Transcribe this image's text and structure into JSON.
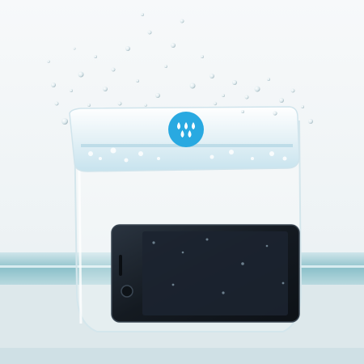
{
  "scene": {
    "description_tags": [
      "water",
      "splash",
      "waterproof-pouch",
      "smartphone",
      "aquarium"
    ],
    "colors": {
      "background": "#f3f6f7",
      "water_band_top": "#bfdbe0",
      "water_band_bottom": "#7fb7c1",
      "pouch_seal": "#e8f4f8",
      "logo_blue": "#29a9e1",
      "phone_body": "#151b22",
      "phone_screen": "#1c2430"
    }
  },
  "brand": {
    "logo_icon": "water-drops-logo-icon"
  }
}
